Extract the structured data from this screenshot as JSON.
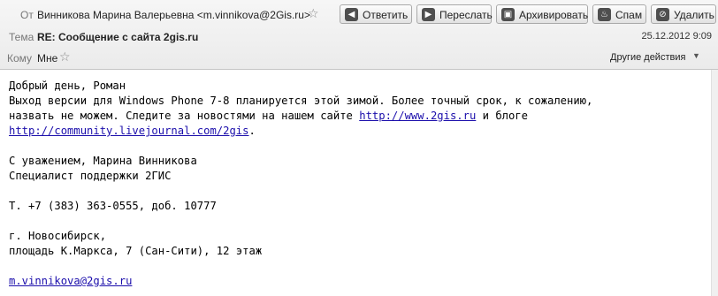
{
  "header": {
    "from_label": "От",
    "from_value": "Винникова Марина Валерьевна <m.vinnikova@2Gis.ru>",
    "subject_label": "Тема",
    "subject_value": "RE: Сообщение с сайта 2gis.ru",
    "date": "25.12.2012 9:09",
    "to_label": "Кому",
    "to_value": "Мне",
    "other_actions": "Другие действия"
  },
  "toolbar": {
    "reply": "Ответить",
    "forward": "Переслать",
    "archive": "Архивировать",
    "spam": "Спам",
    "delete": "Удалить"
  },
  "body": {
    "greeting": "Добрый день, Роман",
    "line1": "Выход версии для Windows Phone 7-8 планируется этой зимой. Более точный срок, к сожалению,",
    "line2_pre": "назвать не можем. Следите за новостями на нашем сайте ",
    "link1": "http://www.2gis.ru",
    "line2_post": " и блоге",
    "link2": "http://community.livejournal.com/2gis",
    "line3_post": ".",
    "sign1": "С уважением, Марина Винникова",
    "sign2": "Специалист поддержки 2ГИС",
    "phone": "Т. +7 (383) 363-0555, доб. 10777",
    "city": "г. Новосибирск,",
    "address": "площадь К.Маркса, 7 (Сан-Сити), 12 этаж",
    "email_link": "m.vinnikova@2gis.ru"
  },
  "icons": {
    "star": "star-outline-icon",
    "reply": "reply-arrow-icon",
    "forward": "forward-arrow-icon",
    "archive": "archive-box-icon",
    "spam": "spam-flame-icon",
    "delete": "delete-circle-icon"
  }
}
